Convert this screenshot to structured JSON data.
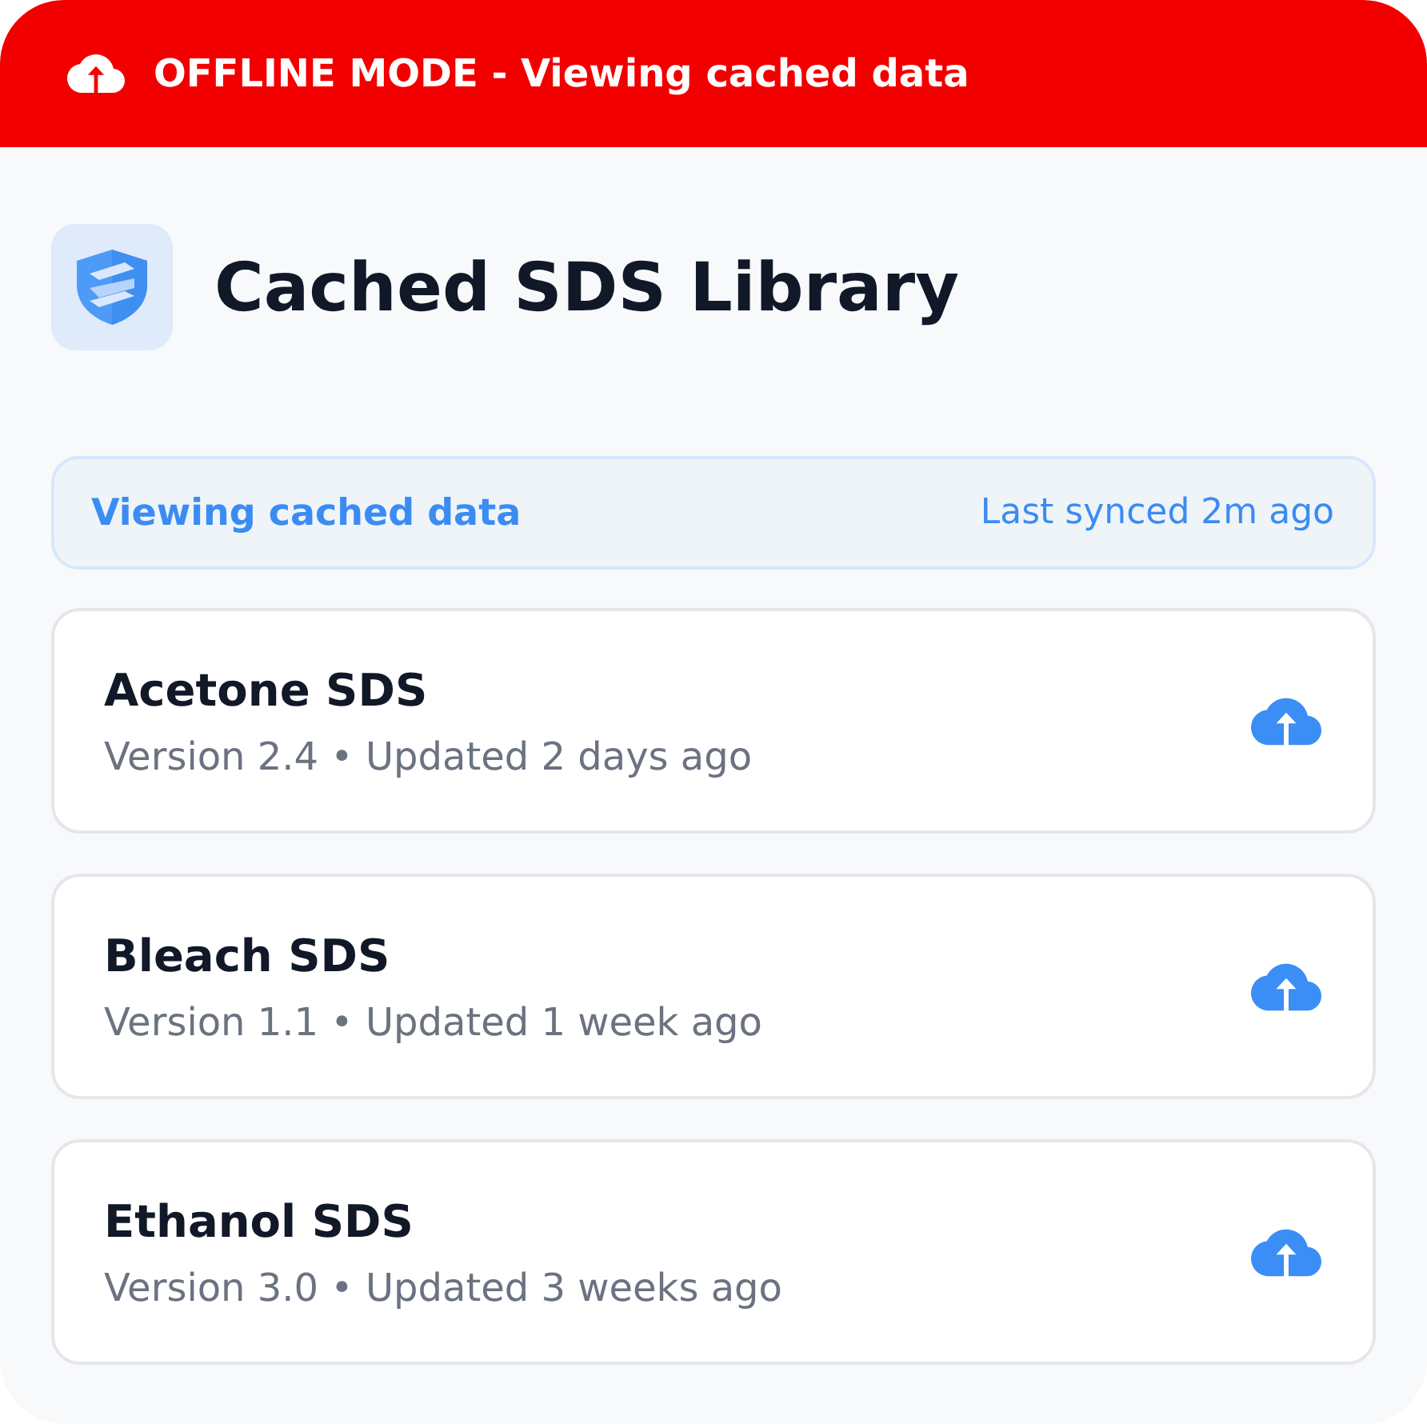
{
  "offline_banner": {
    "text": "OFFLINE MODE - Viewing cached data"
  },
  "header": {
    "title": "Cached SDS Library"
  },
  "cache_notice": {
    "label": "Viewing cached data",
    "last_synced": "Last synced 2m ago"
  },
  "documents": [
    {
      "name": "Acetone SDS",
      "meta": "Version 2.4 • Updated 2 days ago"
    },
    {
      "name": "Bleach SDS",
      "meta": "Version 1.1 • Updated 1 week ago"
    },
    {
      "name": "Ethanol SDS",
      "meta": "Version 3.0 • Updated 3 weeks ago"
    }
  ]
}
